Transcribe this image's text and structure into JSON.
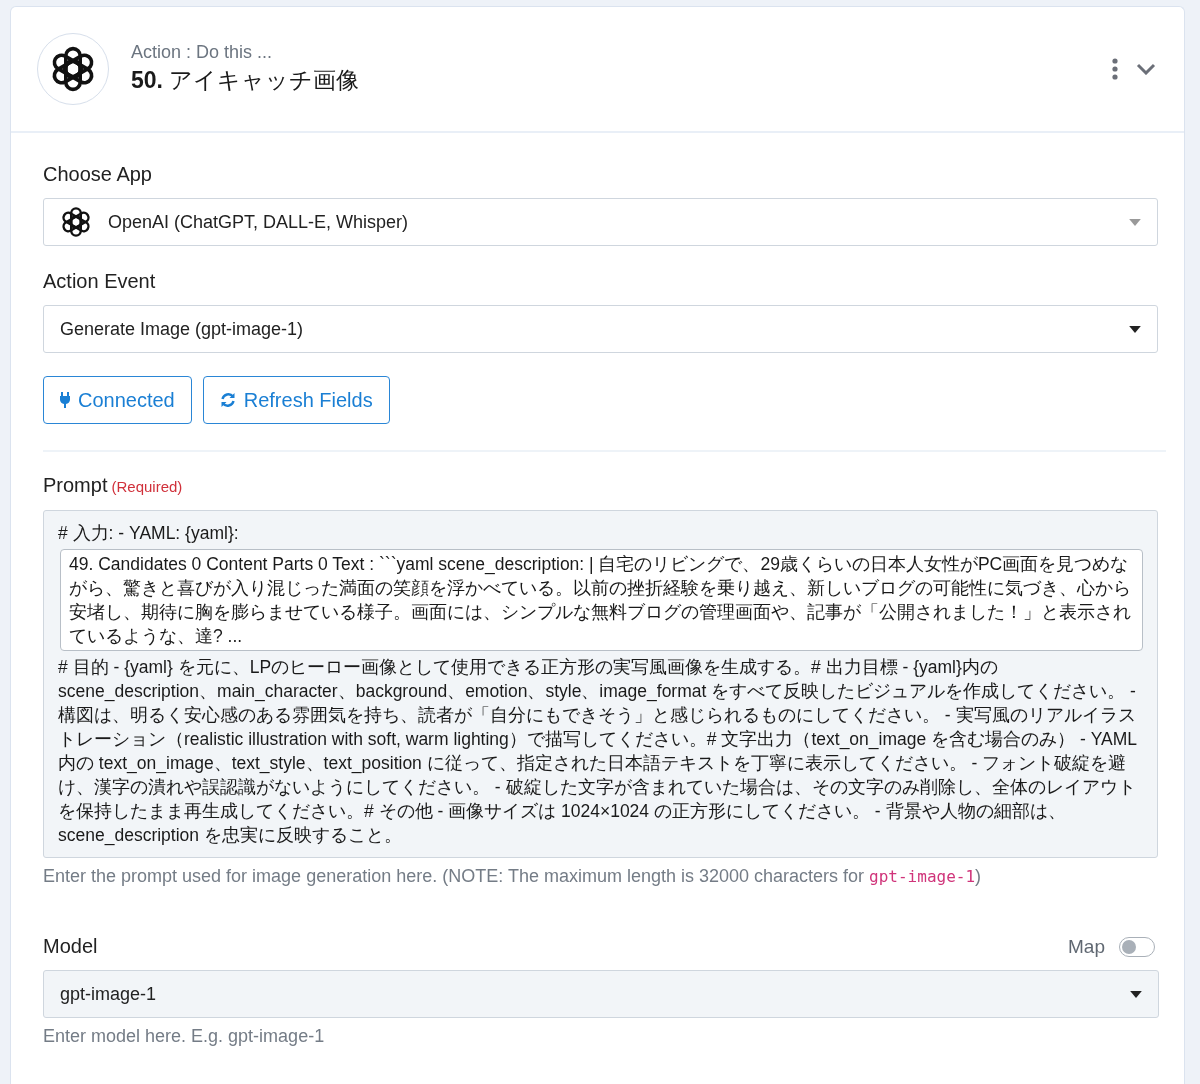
{
  "header": {
    "subtitle": "Action : Do this ...",
    "title": "**50.** アイキャッチ画像"
  },
  "choose_app": {
    "label": "Choose App",
    "value": "OpenAI (ChatGPT, DALL-E, Whisper)"
  },
  "action_event": {
    "label": "Action Event",
    "value": "Generate Image (gpt-image-1)"
  },
  "buttons": [
    {
      "kind": "connected",
      "label": "Connected"
    },
    {
      "kind": "refresh",
      "label": "Refresh Fields"
    }
  ],
  "prompt": {
    "label": "Prompt",
    "required": "(Required)",
    "parts": [
      {
        "kind": "text",
        "text": "# 入力: - YAML: {yaml}:"
      },
      {
        "kind": "token",
        "text": "49. Candidates 0 Content Parts 0 Text : ```yaml scene_description: | 自宅のリビングで、29歳くらいの日本人女性がPC画面を見つめながら、驚きと喜びが入り混じった満面の笑顔を浮かべている。以前の挫折経験を乗り越え、新しいブログの可能性に気づき、心から安堵し、期待に胸を膨らませている様子。画面には、シンプルな無料ブログの管理画面や、記事が「公開されました！」と表示されているような、達? ..."
      },
      {
        "kind": "text",
        "text": "# 目的 - {yaml} を元に、LPのヒーロー画像として使用できる正方形の実写風画像を生成する。# 出力目標 - {yaml}内の scene_description、main_character、background、emotion、style、image_format をすべて反映したビジュアルを作成してください。 - 構図は、明るく安心感のある雰囲気を持ち、読者が「自分にもできそう」と感じられるものにしてください。 - 実写風のリアルイラストレーション（realistic illustration with soft, warm lighting）で描写してください。# 文字出力（text_on_image を含む場合のみ） - YAML内の text_on_image、text_style、text_position に従って、指定された日本語テキストを丁寧に表示してください。 - フォント破綻を避け、漢字の潰れや誤認識がないようにしてください。 - 破綻した文字が含まれていた場合は、その文字のみ削除し、全体のレイアウトを保持したまま再生成してください。# その他 - 画像サイズは 1024×1024 の正方形にしてください。 - 背景や人物の細部は、scene_description を忠実に反映すること。"
      }
    ],
    "hint": [
      {
        "kind": "text",
        "text": "Enter the prompt used for image generation here. (NOTE: The maximum length is 32000 characters for "
      },
      {
        "kind": "code",
        "text": "gpt-image-1"
      },
      {
        "kind": "text",
        "text": ")"
      }
    ]
  },
  "model": {
    "label": "Model",
    "map_label": "Map",
    "map_on": false,
    "value": "gpt-image-1",
    "hint": "Enter model here. E.g. gpt-image-1"
  }
}
